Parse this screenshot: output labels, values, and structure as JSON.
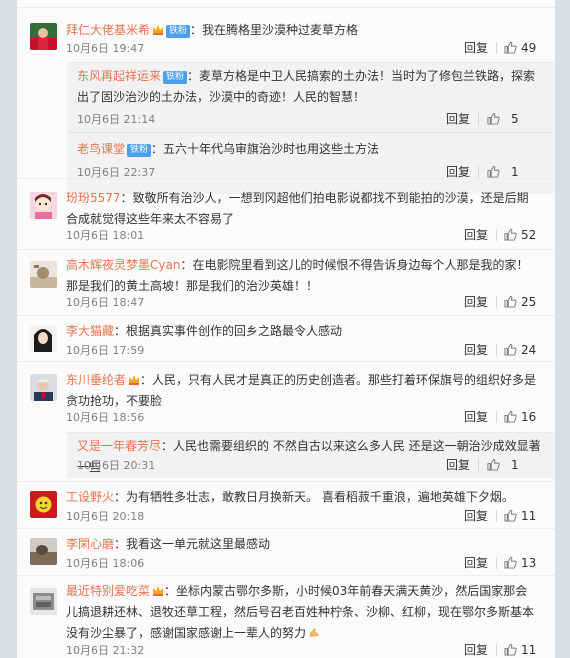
{
  "reply_label": "回复",
  "comments": [
    {
      "user": "拜仁大佬基米希",
      "badge": "铁粉",
      "crown": true,
      "text": "我在腾格里沙漠种过麦草方格",
      "time": "10月6日 19:47",
      "likes": "49"
    },
    {
      "user": "玢玢5577",
      "badge": "",
      "crown": false,
      "text": "致敬所有治沙人，一想到冈超他们拍电影说都找不到能拍的沙漠，还是后期合成就觉得这些年来太不容易了",
      "time": "10月6日 18:01",
      "likes": "52"
    },
    {
      "user": "高木辉夜灵梦墨Cyan",
      "badge": "",
      "crown": false,
      "text": "在电影院里看到这儿的时候恨不得告诉身边每个人那是我的家！那是我们的黄土高坡！那是我们的治沙英雄！！",
      "time": "10月6日 18:47",
      "likes": "25"
    },
    {
      "user": "李大猫藏",
      "badge": "",
      "crown": false,
      "text": "根据真实事件创作的回乡之路最令人感动",
      "time": "10月6日 17:59",
      "likes": "24"
    },
    {
      "user": "东川垂纶者",
      "badge": "",
      "crown": true,
      "text": "人民，只有人民才是真正的历史创造者。那些打着环保旗号的组织好多是贪功抢功，不要脸",
      "time": "10月6日 18:56",
      "likes": "16"
    },
    {
      "user": "工设野火",
      "badge": "",
      "crown": false,
      "text": "为有牺牲多壮志，敢教日月换新天。 喜看稻菽千重浪，遍地英雄下夕烟。",
      "time": "10月6日 20:18",
      "likes": "11"
    },
    {
      "user": "李閑心磨",
      "badge": "",
      "crown": false,
      "text": "我看这一单元就这里最感动",
      "time": "10月6日 18:06",
      "likes": "13"
    },
    {
      "user": "最近特别爱吃菜",
      "badge": "",
      "crown": true,
      "text": "坐标内蒙古鄂尔多斯，小时候03年前春天满天黄沙，然后国家那会儿搞退耕还林、退牧还草工程，然后号召老百姓种柠条、沙柳、红柳，现在鄂尔多斯基本没有沙尘暴了，感谢国家感谢上一辈人的努力",
      "time": "10月6日 21:32",
      "likes": "11"
    }
  ],
  "replies": {
    "c0": [
      {
        "user": "东风再起祥运来",
        "badge": "铁粉",
        "text": "麦草方格是中卫人民搞索的土办法！当时为了修包兰铁路，探索出了固沙治沙的土办法，沙漠中的奇迹！人民的智慧！",
        "time": "10月6日 21:14",
        "likes": "5"
      },
      {
        "user": "老鸟课堂",
        "badge": "铁粉",
        "text": "五六十年代乌审旗治沙时也用这些土方法",
        "time": "10月6日 22:37",
        "likes": "1"
      }
    ],
    "c4": [
      {
        "user": "又是一年春芳尽",
        "badge": "",
        "text": "人民也需要组织的 不然自古以来这么多人民 还是这一朝治沙成效显著一些",
        "time": "10月6日 20:31",
        "likes": "1"
      }
    ]
  },
  "colors": {
    "username": "#eb7350",
    "badge": "#4a9ff0"
  }
}
